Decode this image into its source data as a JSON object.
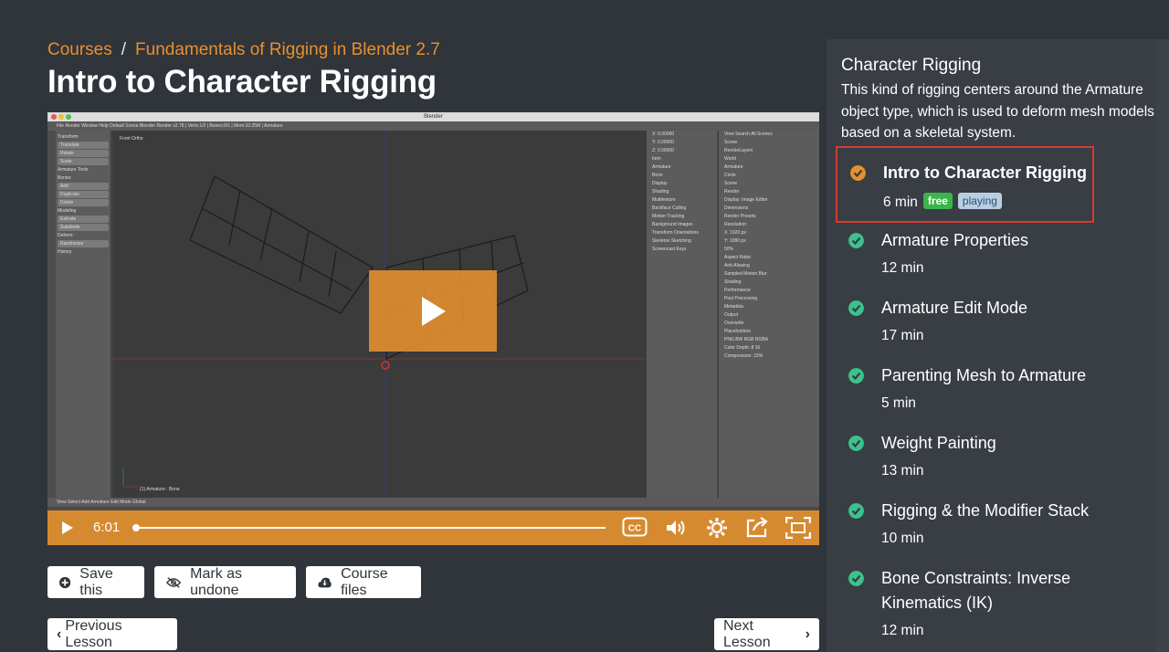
{
  "breadcrumb": {
    "courses": "Courses",
    "separator": "/",
    "course": "Fundamentals of Rigging in Blender 2.7"
  },
  "page_title": "Intro to Character Rigging",
  "video": {
    "blender_title": "Blender",
    "topbar_text": "File  Render  Window  Help      Default          Scene          Blender Render      v2.78 | Verts:1/2 | Bones:0/1 | Mem:10.25M | Armature",
    "toolshelf": [
      "Transform",
      "Translate",
      "Rotate",
      "Scale",
      "Armature Tools",
      "Bones:",
      "Add",
      "Duplicate",
      "Delete",
      "Modeling",
      "Extrude",
      "Subdivide",
      "Deform:",
      "Randomize",
      "History"
    ],
    "viewport_label": "Front Ortho",
    "viewport_status": "(1) Armature : Bone",
    "props_panel": [
      "X: 0.00000",
      "Y: 0.00000",
      "Z: 0.00000",
      "Item",
      "Armature",
      "Bone",
      "Display",
      "Shading",
      "Multitexture",
      "Backface Culling",
      "Motion Tracking",
      "Background Images",
      "Transform Orientations",
      "Skeleton Sketching",
      "Screencast Keys"
    ],
    "outliner_panel": [
      "View  Search  All Scenes",
      "Scene",
      "RenderLayers",
      "World",
      "Armature",
      "Circle",
      "Scene",
      "Render",
      "Display: Image Editor",
      "Dimensions",
      "Render Presets",
      "Resolution:",
      "X: 1920 px",
      "Y: 1080 px",
      "50%",
      "Aspect Ratio:",
      "Anti-Aliasing",
      "Sampled Motion Blur",
      "Shading",
      "Performance",
      "Post Processing",
      "Metadata",
      "Output",
      "Overwrite",
      "Placeholders",
      "PNG  BW RGB RGBA",
      "Color Depth: 8  16",
      "Compression: 15%"
    ],
    "bottombar_text": "View  Select  Add  Armature   Edit Mode      Global",
    "time": "6:01",
    "progress": 0.0
  },
  "actions": {
    "save": "Save this",
    "mark_undone": "Mark as undone",
    "course_files": "Course files"
  },
  "nav": {
    "previous": "Previous Lesson",
    "next": "Next Lesson"
  },
  "sidebar": {
    "title": "Character Rigging",
    "description": "This kind of rigging centers around the Armature object type, which is used to deform mesh models based on a skeletal system.",
    "lessons": [
      {
        "name": "Intro to Character Rigging",
        "duration": "6 min",
        "status": "current",
        "badges": [
          "free",
          "playing"
        ]
      },
      {
        "name": "Armature Properties",
        "duration": "12 min",
        "status": "done"
      },
      {
        "name": "Armature Edit Mode",
        "duration": "17 min",
        "status": "done"
      },
      {
        "name": "Parenting Mesh to Armature",
        "duration": "5 min",
        "status": "done"
      },
      {
        "name": "Weight Painting",
        "duration": "13 min",
        "status": "done"
      },
      {
        "name": "Rigging & the Modifier Stack",
        "duration": "10 min",
        "status": "done"
      },
      {
        "name": "Bone Constraints: Inverse Kinematics (IK)",
        "duration": "12 min",
        "status": "done"
      }
    ]
  },
  "colors": {
    "accent": "#e6912e",
    "done": "#3cc28c",
    "current": "#e6912e",
    "active_border": "#d63b2d",
    "background": "#30343b"
  }
}
